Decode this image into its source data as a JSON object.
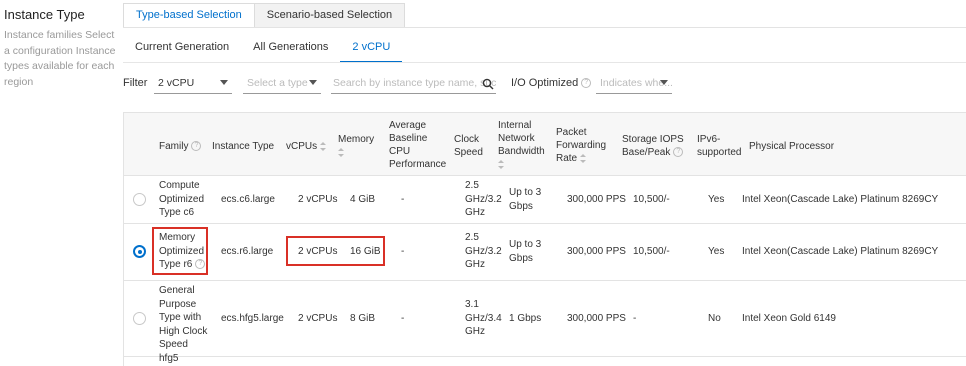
{
  "sidebar": {
    "title": "Instance Type",
    "description": "Instance families Select a configuration Instance types available for each region"
  },
  "tabs": [
    {
      "label": "Type-based Selection",
      "active": true
    },
    {
      "label": "Scenario-based Selection",
      "active": false
    }
  ],
  "subtabs": [
    {
      "label": "Current Generation",
      "active": false
    },
    {
      "label": "All Generations",
      "active": false
    },
    {
      "label": "2 vCPU",
      "active": true
    }
  ],
  "filters": {
    "label": "Filter",
    "vcpu_value": "2 vCPU",
    "type_placeholder": "Select a type",
    "search_placeholder": "Search by instance type name, such",
    "io_label": "I/O Optimized",
    "io_placeholder": "Indicates whe..."
  },
  "table": {
    "headers": {
      "family": "Family",
      "type": "Instance Type",
      "vcpus": "vCPUs",
      "memory": "Memory",
      "baseline": "Average Baseline CPU Performance",
      "clock": "Clock Speed",
      "bandwidth": "Internal Network Bandwidth",
      "pps": "Packet Forwarding Rate",
      "iops": "Storage IOPS Base/Peak",
      "ipv6": "IPv6-supported",
      "processor": "Physical Processor"
    },
    "rows": [
      {
        "family": "Compute Optimized Type c6",
        "type": "ecs.c6.large",
        "vcpus": "2 vCPUs",
        "memory": "4 GiB",
        "baseline": "-",
        "clock": "2.5 GHz/3.2 GHz",
        "bandwidth": "Up to 3 Gbps",
        "pps": "300,000 PPS",
        "iops": "10,500/-",
        "ipv6": "Yes",
        "processor": "Intel Xeon(Cascade Lake) Platinum 8269CY",
        "selected": false
      },
      {
        "family": "Memory Optimized Type r6",
        "type": "ecs.r6.large",
        "vcpus": "2 vCPUs",
        "memory": "16 GiB",
        "baseline": "-",
        "clock": "2.5 GHz/3.2 GHz",
        "bandwidth": "Up to 3 Gbps",
        "pps": "300,000 PPS",
        "iops": "10,500/-",
        "ipv6": "Yes",
        "processor": "Intel Xeon(Cascade Lake) Platinum 8269CY",
        "selected": true
      },
      {
        "family": "General Purpose Type with High Clock Speed hfg5",
        "type": "ecs.hfg5.large",
        "vcpus": "2 vCPUs",
        "memory": "8 GiB",
        "baseline": "-",
        "clock": "3.1 GHz/3.4 GHz",
        "bandwidth": "1 Gbps",
        "pps": "300,000 PPS",
        "iops": "-",
        "ipv6": "No",
        "processor": "Intel Xeon Gold 6149",
        "selected": false
      }
    ]
  },
  "colors": {
    "accent": "#0070cc",
    "highlight": "#d93026"
  }
}
